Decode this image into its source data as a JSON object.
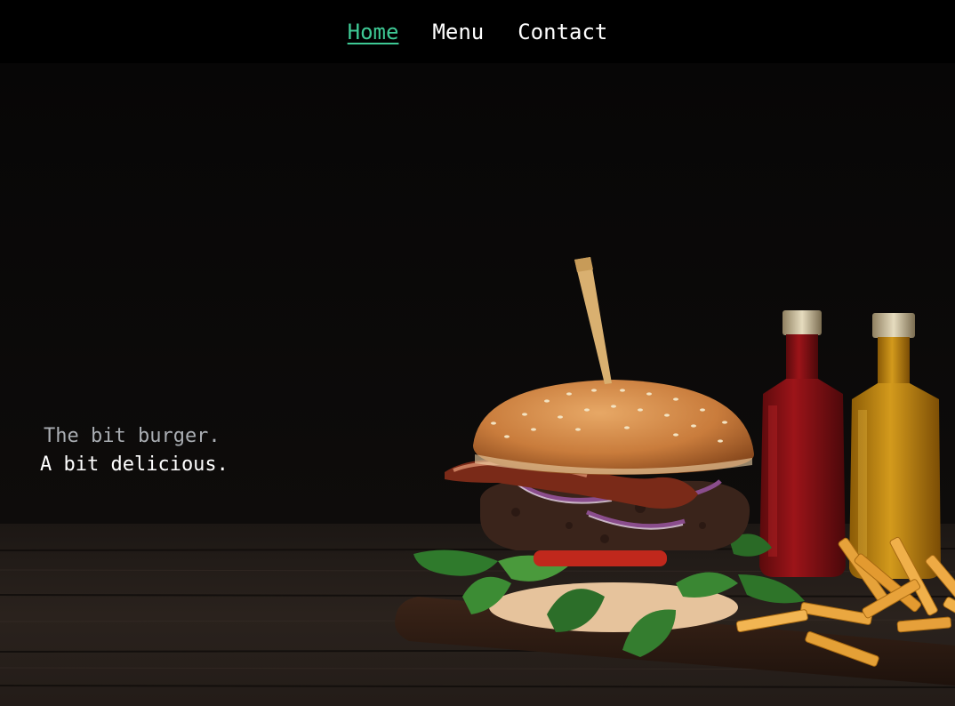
{
  "nav": {
    "items": [
      {
        "label": "Home",
        "active": true
      },
      {
        "label": "Menu",
        "active": false
      },
      {
        "label": "Contact",
        "active": false
      }
    ],
    "active_color": "#3ec995"
  },
  "hero": {
    "tagline_line1": "The bit burger.",
    "tagline_line2": "A bit delicious."
  },
  "colors": {
    "background": "#0b0a0a",
    "navbar": "#000000",
    "text": "#ffffff",
    "tagline_muted": "#a9adb2"
  }
}
